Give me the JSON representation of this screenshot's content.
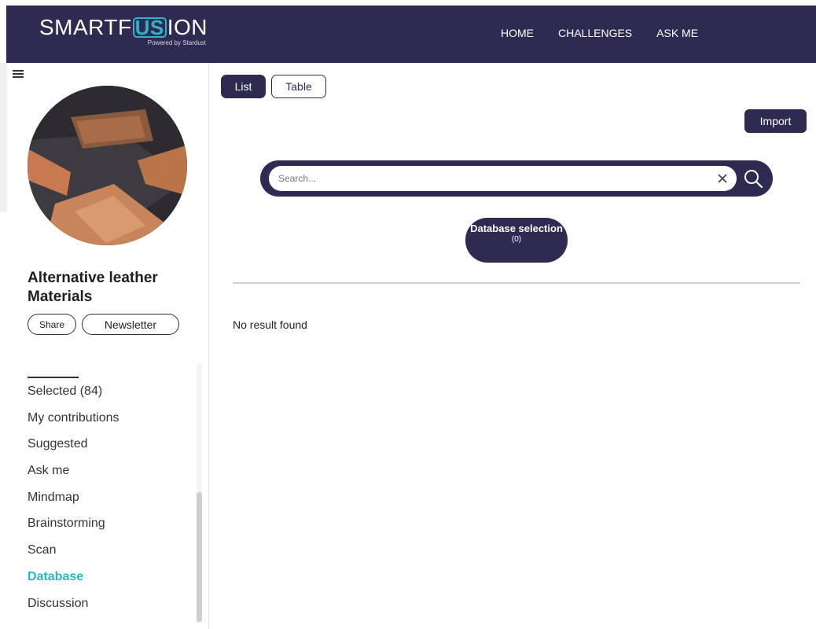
{
  "header": {
    "logo_prefix": "SMARTF",
    "logo_highlight": "US",
    "logo_suffix": "ION",
    "logo_tagline": "Powered by Stardust",
    "nav": [
      "HOME",
      "CHALLENGES",
      "ASK ME"
    ]
  },
  "sidebar": {
    "project_title": "Alternative leather Materials",
    "share_label": "Share",
    "newsletter_label": "Newsletter",
    "menu": [
      {
        "label": "Selected (84)",
        "active": false
      },
      {
        "label": "My contributions",
        "active": false
      },
      {
        "label": "Suggested",
        "active": false
      },
      {
        "label": "Ask me",
        "active": false
      },
      {
        "label": "Mindmap",
        "active": false
      },
      {
        "label": "Brainstorming",
        "active": false
      },
      {
        "label": "Scan",
        "active": false
      },
      {
        "label": "Database",
        "active": true
      },
      {
        "label": "Discussion",
        "active": false
      }
    ]
  },
  "main": {
    "view_list_label": "List",
    "view_table_label": "Table",
    "import_label": "Import",
    "search_placeholder": "Search...",
    "database_selection_label": "Database selection",
    "database_selection_count": "(0)",
    "no_result_text": "No result found"
  },
  "colors": {
    "primary": "#2f2a52",
    "accent": "#2fb3c4"
  }
}
